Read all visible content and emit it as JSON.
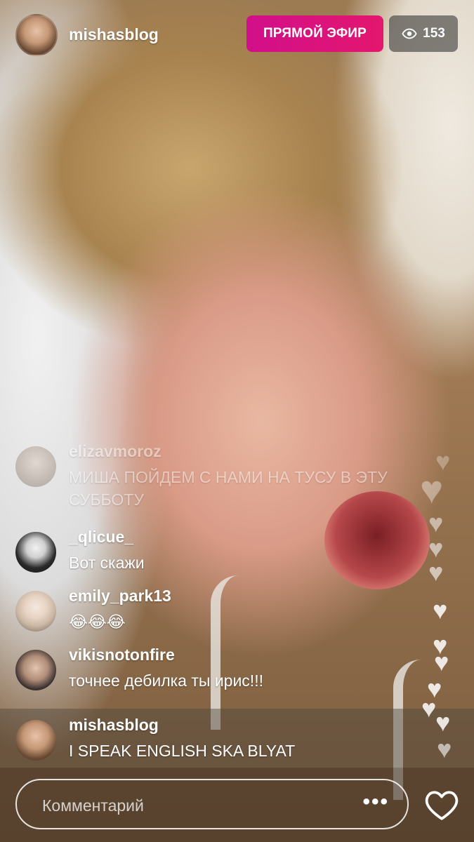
{
  "header": {
    "username": "mishasblog",
    "live_label": "ПРЯМОЙ ЭФИР",
    "viewer_count": "153",
    "viewer_icon": "eye-icon"
  },
  "comments": [
    {
      "user": "elizavmoroz",
      "text": "МИША ПОЙДЕМ С НАМИ НА ТУСУ В ЭТУ СУББОТУ"
    },
    {
      "user": "_qlicue_",
      "text": "Вот скажи"
    },
    {
      "user": "emily_park13",
      "text": "😂😂😂"
    },
    {
      "user": "vikisnotonfire",
      "text": "точнее дебилка ты ирис!!!"
    },
    {
      "user": "mishasblog",
      "text": "I SPEAK ENGLISH SKA BLYAT"
    }
  ],
  "bottom_bar": {
    "placeholder": "Комментарий",
    "more_icon": "more-dots-icon",
    "like_icon": "heart-outline-icon"
  },
  "colors": {
    "live_badge": "#e0127a",
    "viewer_badge": "#3a3a3a"
  }
}
